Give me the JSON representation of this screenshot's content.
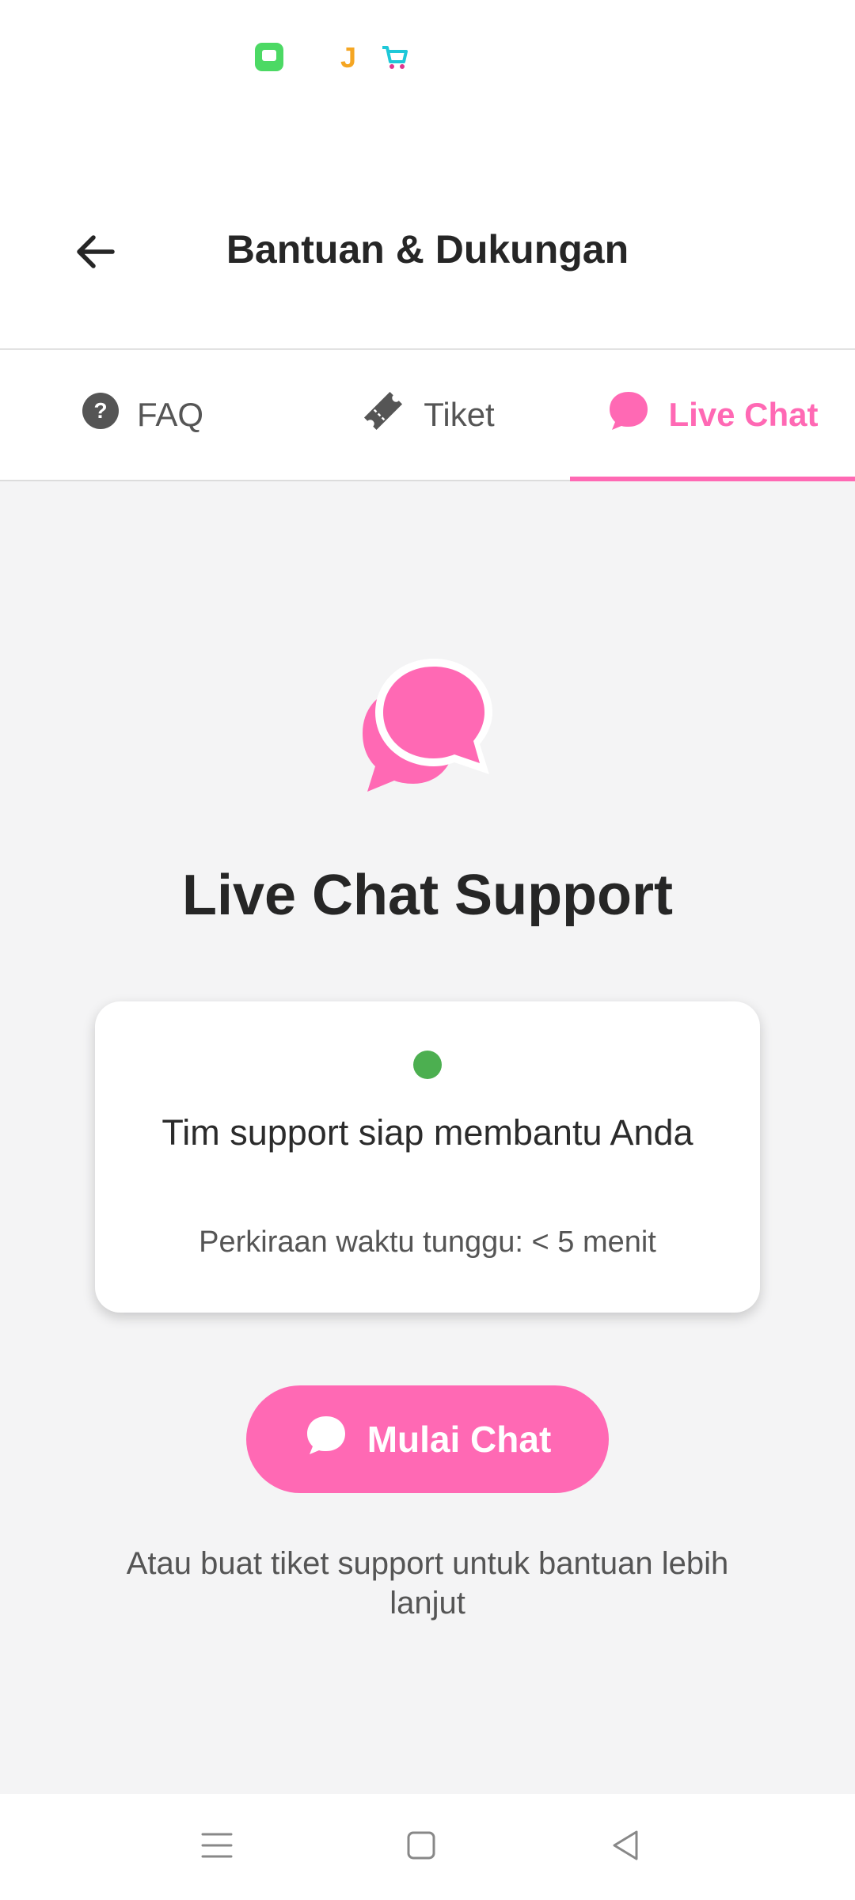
{
  "header": {
    "title": "Bantuan & Dukungan"
  },
  "tabs": [
    {
      "label": "FAQ",
      "icon": "help-circle-icon",
      "active": false
    },
    {
      "label": "Tiket",
      "icon": "ticket-icon",
      "active": false
    },
    {
      "label": "Live Chat",
      "icon": "chat-bubble-icon",
      "active": true
    }
  ],
  "main": {
    "title": "Live Chat Support",
    "status_card": {
      "message": "Tim support siap membantu Anda",
      "wait_time": "Perkiraan waktu tunggu: < 5 menit",
      "status_color": "#4caf50"
    },
    "start_button_label": "Mulai Chat",
    "footer_note": "Atau buat tiket support untuk bantuan lebih lanjut"
  },
  "colors": {
    "accent": "#ff69b4",
    "background": "#f4f4f5",
    "online": "#4caf50"
  },
  "status_bar": {
    "icons": [
      "messages-app-icon",
      "j-app-icon",
      "shopping-cart-app-icon"
    ]
  },
  "nav_bar": {
    "icons": [
      "menu-icon",
      "home-square-icon",
      "back-triangle-icon"
    ]
  }
}
